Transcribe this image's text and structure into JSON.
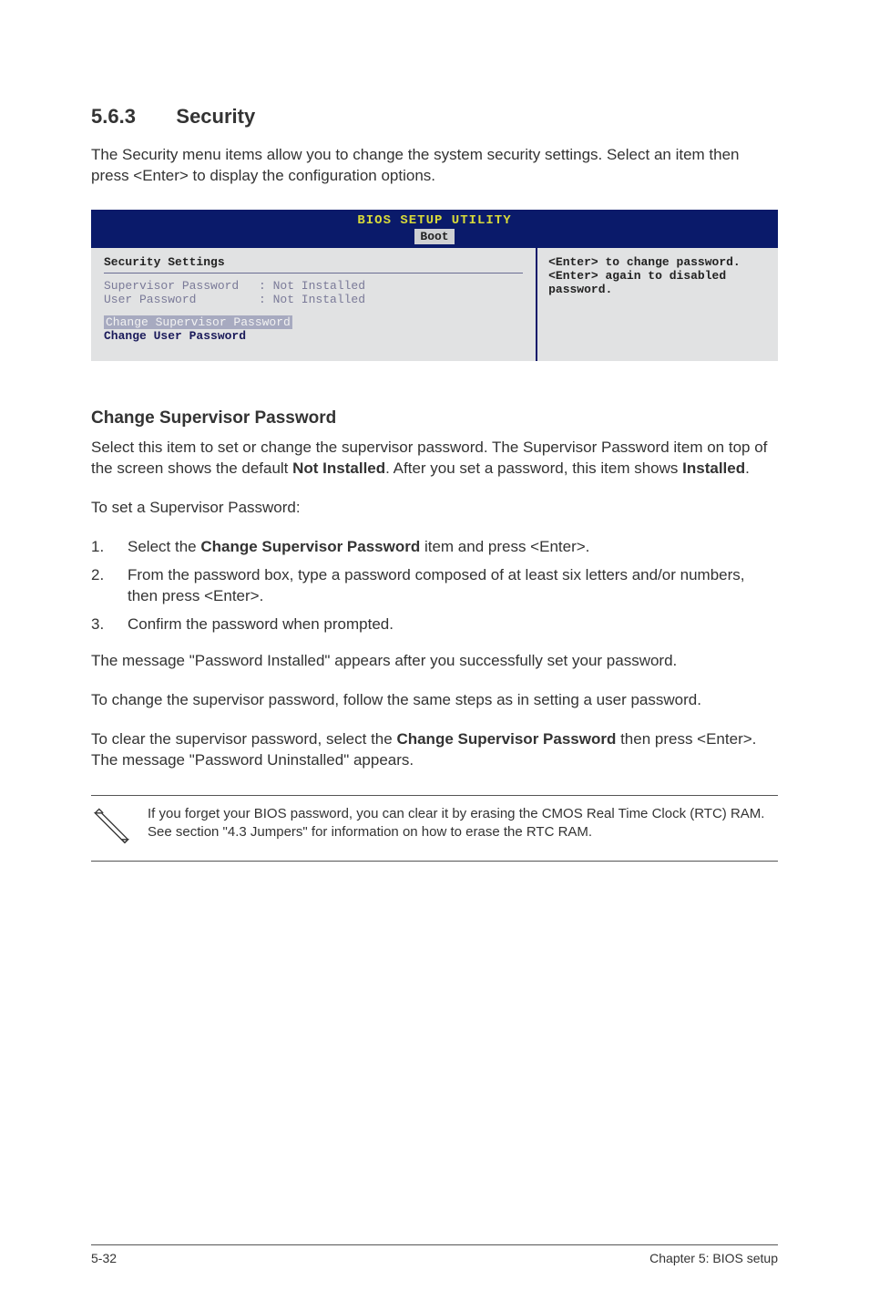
{
  "section": {
    "number": "5.6.3",
    "title": "Security"
  },
  "intro": "The Security menu items allow you to change the system security settings. Select an item then press <Enter> to display the configuration options.",
  "bios": {
    "header": "BIOS SETUP UTILITY",
    "tab": "Boot",
    "left": {
      "title": "Security Settings",
      "rows": [
        {
          "label": "Supervisor Password",
          "value": ": Not Installed"
        },
        {
          "label": "User Password",
          "value": ": Not Installed"
        }
      ],
      "highlight": "Change Supervisor Password",
      "user_line": "Change User Password"
    },
    "right": {
      "line1": "<Enter> to change password.",
      "line2": "<Enter> again to disabled password."
    }
  },
  "sub_heading": "Change Supervisor Password",
  "para1_a": "Select this item to set or change the supervisor password. The Supervisor Password item on top of the screen shows the default ",
  "para1_bold1": "Not Installed",
  "para1_b": ". After you set a password, this item shows ",
  "para1_bold2": "Installed",
  "para1_c": ".",
  "para2": "To set a Supervisor Password:",
  "steps": [
    {
      "n": "1.",
      "a": "Select the ",
      "bold": "Change Supervisor Password",
      "b": " item and press <Enter>."
    },
    {
      "n": "2.",
      "a": "From the password box, type a password composed of at least six letters and/or numbers, then press <Enter>.",
      "bold": "",
      "b": ""
    },
    {
      "n": "3.",
      "a": "Confirm the password when prompted.",
      "bold": "",
      "b": ""
    }
  ],
  "para3": "The message \"Password Installed\" appears after you successfully set your password.",
  "para4": "To change the supervisor password, follow the same steps as in setting a user password.",
  "para5_a": "To clear the supervisor password, select the ",
  "para5_bold": "Change Supervisor Password",
  "para5_b": " then press <Enter>. The message \"Password Uninstalled\" appears.",
  "note": "If you forget your BIOS password, you can clear it by erasing the CMOS Real Time Clock (RTC) RAM. See section \"4.3 Jumpers\" for information on how to erase the RTC RAM.",
  "footer": {
    "left": "5-32",
    "right": "Chapter 5: BIOS setup"
  }
}
